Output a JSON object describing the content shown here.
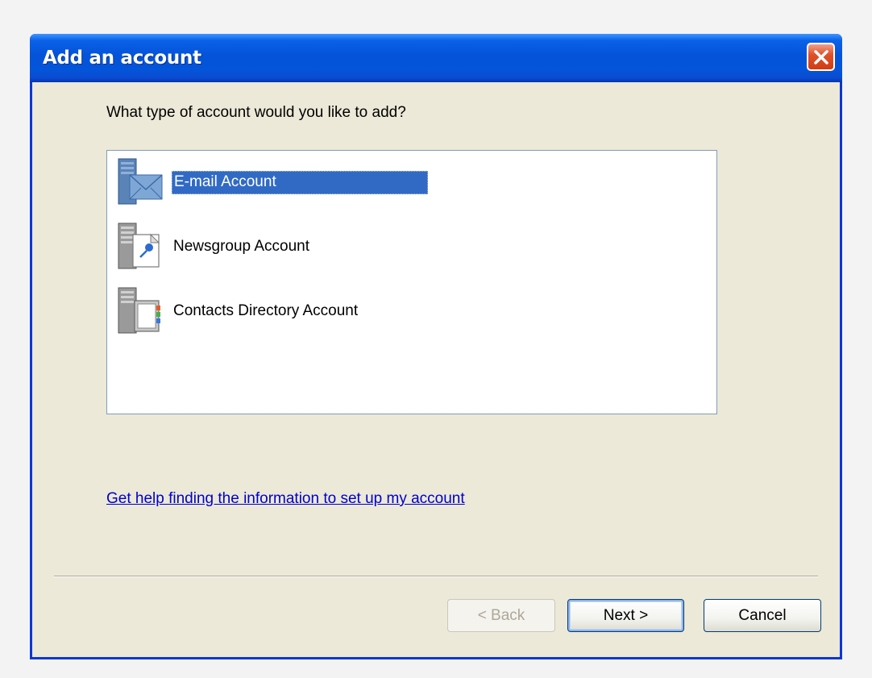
{
  "window": {
    "title": "Add an account"
  },
  "dialog": {
    "prompt": "What type of account would you like to add?",
    "account_types": [
      {
        "label": "E-mail Account",
        "icon": "email-server-icon",
        "selected": true
      },
      {
        "label": "Newsgroup Account",
        "icon": "newsgroup-server-icon",
        "selected": false
      },
      {
        "label": "Contacts Directory Account",
        "icon": "directory-server-icon",
        "selected": false
      }
    ],
    "help_link": "Get help finding the information to set up my account"
  },
  "buttons": {
    "back": "< Back",
    "next": "Next >",
    "cancel": "Cancel"
  },
  "colors": {
    "titlebar": "#0453d8",
    "selection": "#316ac5",
    "dialog_bg": "#ece9d8",
    "link": "#0000cc"
  }
}
